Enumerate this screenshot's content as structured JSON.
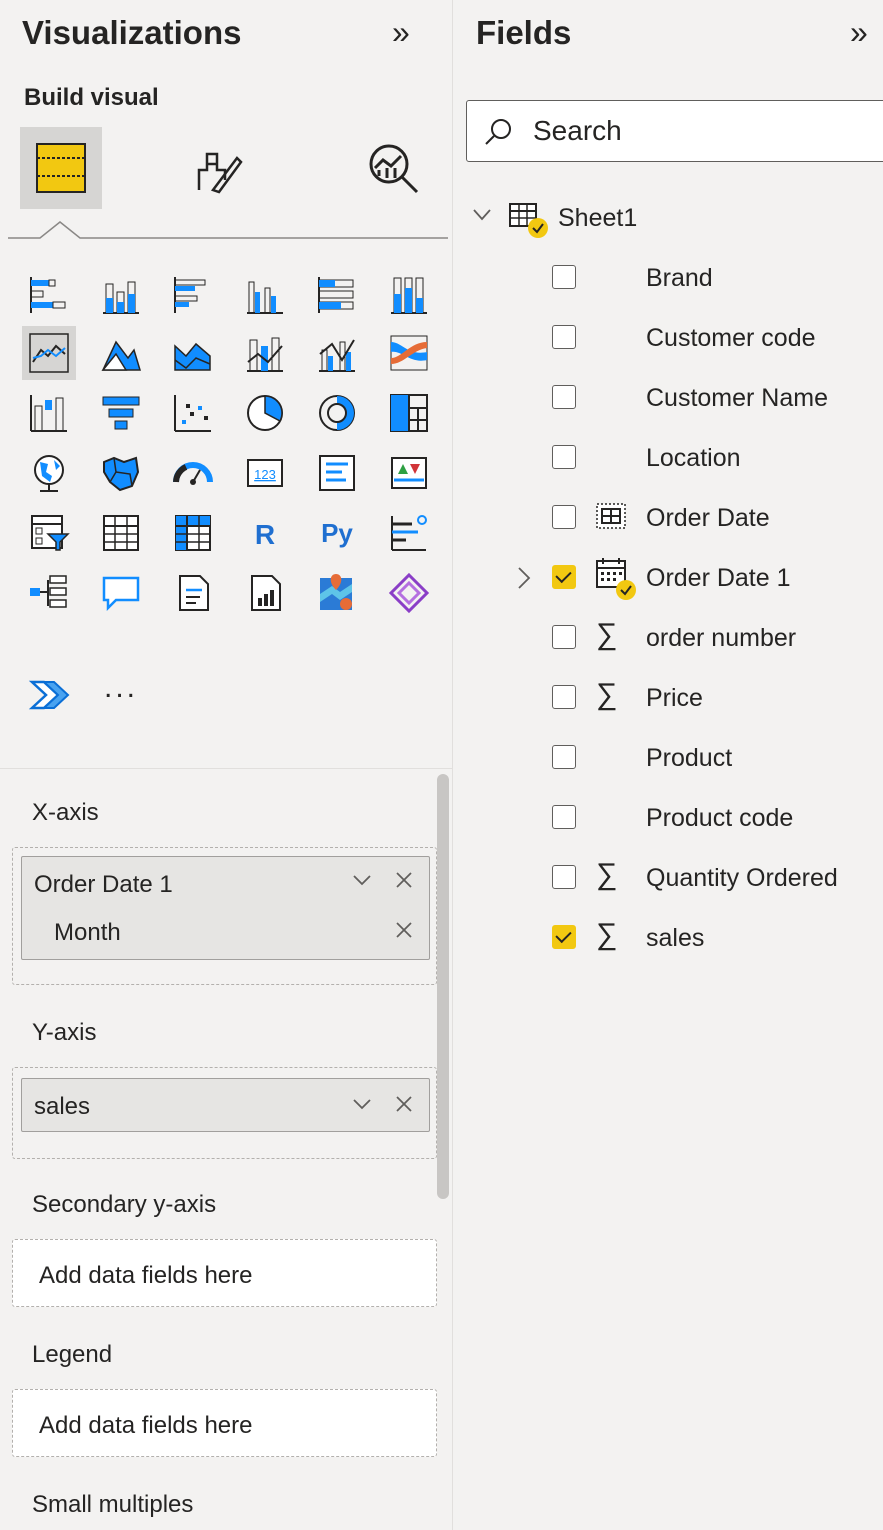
{
  "visualizations": {
    "title": "Visualizations",
    "collapse_glyph": "»",
    "build_label": "Build visual",
    "modes": [
      "build-visual-icon",
      "format-visual-icon",
      "analytics-icon"
    ],
    "more_glyph": "..."
  },
  "wells": {
    "x_axis": {
      "label": "X-axis",
      "field": "Order Date 1",
      "sub_field": "Month"
    },
    "y_axis": {
      "label": "Y-axis",
      "field": "sales"
    },
    "secondary_y_axis": {
      "label": "Secondary y-axis",
      "placeholder": "Add data fields here"
    },
    "legend": {
      "label": "Legend",
      "placeholder": "Add data fields here"
    },
    "small_multiples": {
      "label": "Small multiples"
    }
  },
  "fields": {
    "title": "Fields",
    "collapse_glyph": "»",
    "search_placeholder": "Search",
    "table_name": "Sheet1",
    "items": [
      {
        "label": "Brand",
        "checked": false,
        "icon": "none"
      },
      {
        "label": "Customer code",
        "checked": false,
        "icon": "none"
      },
      {
        "label": "Customer Name",
        "checked": false,
        "icon": "none"
      },
      {
        "label": "Location",
        "checked": false,
        "icon": "none"
      },
      {
        "label": "Order Date",
        "checked": false,
        "icon": "date-hierarchy-icon"
      },
      {
        "label": "Order Date 1",
        "checked": true,
        "icon": "calendar-icon",
        "expandable": true
      },
      {
        "label": "order number",
        "checked": false,
        "icon": "sigma-icon"
      },
      {
        "label": "Price",
        "checked": false,
        "icon": "sigma-icon"
      },
      {
        "label": "Product",
        "checked": false,
        "icon": "none"
      },
      {
        "label": "Product code",
        "checked": false,
        "icon": "none"
      },
      {
        "label": "Quantity Ordered",
        "checked": false,
        "icon": "sigma-icon"
      },
      {
        "label": "sales",
        "checked": true,
        "icon": "sigma-icon"
      }
    ]
  },
  "colors": {
    "accent_yellow": "#f2c811",
    "chart_blue": "#118dff",
    "pane_bg": "#f3f2f1",
    "chip_bg": "#e6e5e3"
  }
}
